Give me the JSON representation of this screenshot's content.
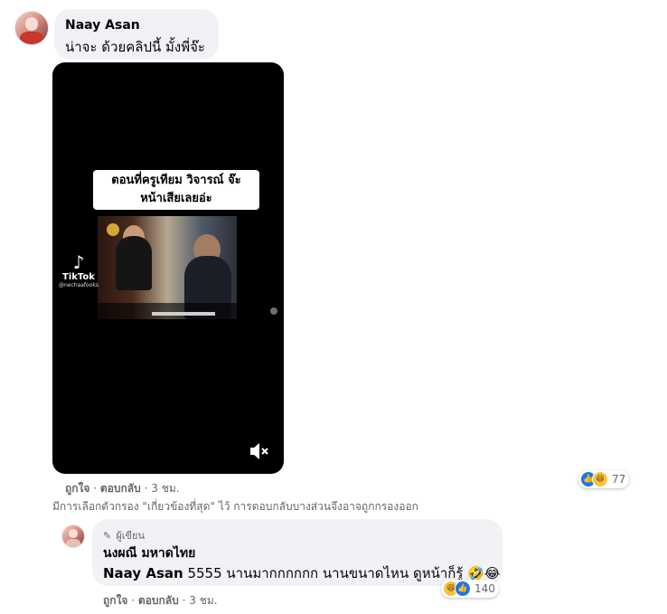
{
  "comment": {
    "author": "Naay Asan",
    "text": "น่าจะ ด้วยคลิปนี้ มั้งพี่จ๊ะ",
    "video": {
      "caption_line1": "ตอนที่ครูเทียม วิจารณ์ จ๊ะ",
      "caption_line2": "หน้าเสียเลยอ่ะ",
      "tiktok_label": "TikTok",
      "tiktok_handle": "@nechaafooks"
    },
    "actions": {
      "like": "ถูกใจ",
      "sep1": "·",
      "reply": "ตอบกลับ",
      "sep2": "·",
      "time": "3 ชม."
    },
    "reaction_count": "77"
  },
  "filter_note": "มีการเลือกตัวกรอง \"เกี่ยวข้องที่สุด\" ไว้ การตอบกลับบางส่วนจึงอาจถูกกรองออก",
  "reply": {
    "badge": "ผู้เขียน",
    "author": "นงผณี มหาดไทย",
    "mention": "Naay Asan",
    "text": "5555 นานมากกกกกก นานขนาดไหน ดูหน้าก็รู้",
    "actions": {
      "like": "ถูกใจ",
      "sep1": "·",
      "reply": "ตอบกลับ",
      "sep2": "·",
      "time": "3 ชม."
    },
    "reaction_count": "140"
  },
  "icons": [
    "avatar",
    "tiktok-icon",
    "mute-icon",
    "like-reaction-icon",
    "haha-reaction-icon",
    "pen-icon",
    "laugh-emoji-icon"
  ],
  "colors": {
    "bubble": "#f0f2f5",
    "like_blue": "#1877f2",
    "haha_yellow": "#f7c33b",
    "meta_gray": "#65676b"
  }
}
